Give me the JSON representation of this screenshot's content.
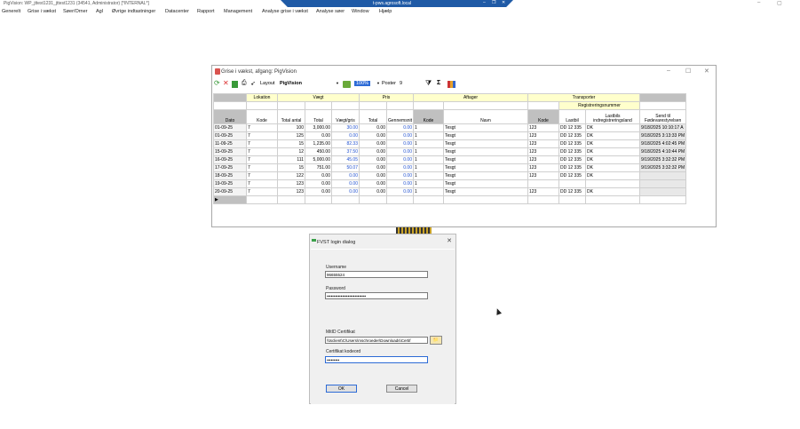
{
  "titlebar": {
    "text": "PigVision: WP_jttest1231_jttest1231 (34541, Administrator) [*INTERNAL*]",
    "remote_host": "t-pws.agrosoft.local",
    "min": "–",
    "restore": "❐",
    "close": "✕",
    "win_min": "–",
    "win_max": "▢"
  },
  "menu": [
    "Generelt",
    "Grise i vækst",
    "Søer/Orner",
    "Agl",
    "Øvrige indtastninger",
    "Datacenter",
    "Rapport",
    "Management",
    "Analyse grise i vækst",
    "Analyse søer",
    "Window",
    "Hjælp"
  ],
  "grid_window": {
    "title": "Grise i vækst, afgang: PigVision",
    "min": "–",
    "max": "☐",
    "close": "✕",
    "toolbar": {
      "layout_label": "Layout",
      "layout_value": "PigVision",
      "zoom": "100%",
      "poster_label": "Poster",
      "poster_count": "9",
      "sigma": "Σ"
    },
    "group_headers": {
      "lokation": "Lokation",
      "vaegt": "Vægt",
      "pris": "Pris",
      "aftager": "Aftager",
      "transporter": "Transporter",
      "registrering": "Registreringsnummer"
    },
    "columns": [
      "Dato",
      "Kode",
      "Total antal",
      "Total",
      "Vægt/gris",
      "Total",
      "Gennemsnit",
      "Kode",
      "Navn",
      "Kode",
      "Lastbil",
      "Lastbils indregistreringsland",
      "Send til Fødevarestyrelsen"
    ],
    "rows": [
      [
        "01-09-25",
        "7",
        "100",
        "3,000.00",
        "30.00",
        "0.00",
        "0.00",
        "1",
        "Tesgt",
        "123",
        "DD 12 335",
        "DK",
        "9/18/2025 10:10:17 A"
      ],
      [
        "01-09-25",
        "7",
        "125",
        "0.00",
        "0.00",
        "0.00",
        "0.00",
        "1",
        "Tesgt",
        "123",
        "DD 12 335",
        "DK",
        "9/18/2025 3:13:33 PM"
      ],
      [
        "11-09-25",
        "7",
        "15",
        "1,235.00",
        "82.33",
        "0.00",
        "0.00",
        "1",
        "Tesgt",
        "123",
        "DD 12 335",
        "DK",
        "9/18/2025 4:02:45 PM"
      ],
      [
        "15-09-25",
        "7",
        "12",
        "450.00",
        "37.50",
        "0.00",
        "0.00",
        "1",
        "Tesgt",
        "123",
        "DD 12 335",
        "DK",
        "9/18/2025 4:10:44 PM"
      ],
      [
        "16-09-25",
        "7",
        "111",
        "5,000.00",
        "45.05",
        "0.00",
        "0.00",
        "1",
        "Tesgt",
        "123",
        "DD 12 335",
        "DK",
        "9/19/2025 3:32:32 PM"
      ],
      [
        "17-09-25",
        "7",
        "15",
        "751.00",
        "50.07",
        "0.00",
        "0.00",
        "1",
        "Tesgt",
        "123",
        "DD 12 335",
        "DK",
        "9/19/2025 3:32:32 PM"
      ],
      [
        "18-09-25",
        "7",
        "122",
        "0.00",
        "0.00",
        "0.00",
        "0.00",
        "1",
        "Tesgt",
        "123",
        "DD 12 335",
        "DK",
        ""
      ],
      [
        "19-09-25",
        "7",
        "123",
        "0.00",
        "0.00",
        "0.00",
        "0.00",
        "1",
        "Tesgt",
        "",
        "",
        "",
        ""
      ],
      [
        "20-09-25",
        "7",
        "123",
        "0.00",
        "0.00",
        "0.00",
        "0.00",
        "1",
        "Tesgt",
        "123",
        "DD 12 335",
        "DK",
        ""
      ]
    ],
    "new_row_marker": "▶"
  },
  "dialog": {
    "title": "FVST login dialog",
    "close": "✕",
    "username_label": "Username",
    "username_value": "96655524",
    "password_label": "Password",
    "password_value": "••••••••••••••••••••••••••••",
    "cert_label": "MitID Certifikat",
    "cert_value": "\\\\tsclient\\C\\Users\\mschroeder\\Downloads\\Certif",
    "certpw_label": "Certifikat kodeord",
    "certpw_value": "•••••••••",
    "ok": "OK",
    "cancel": "Cancel"
  }
}
